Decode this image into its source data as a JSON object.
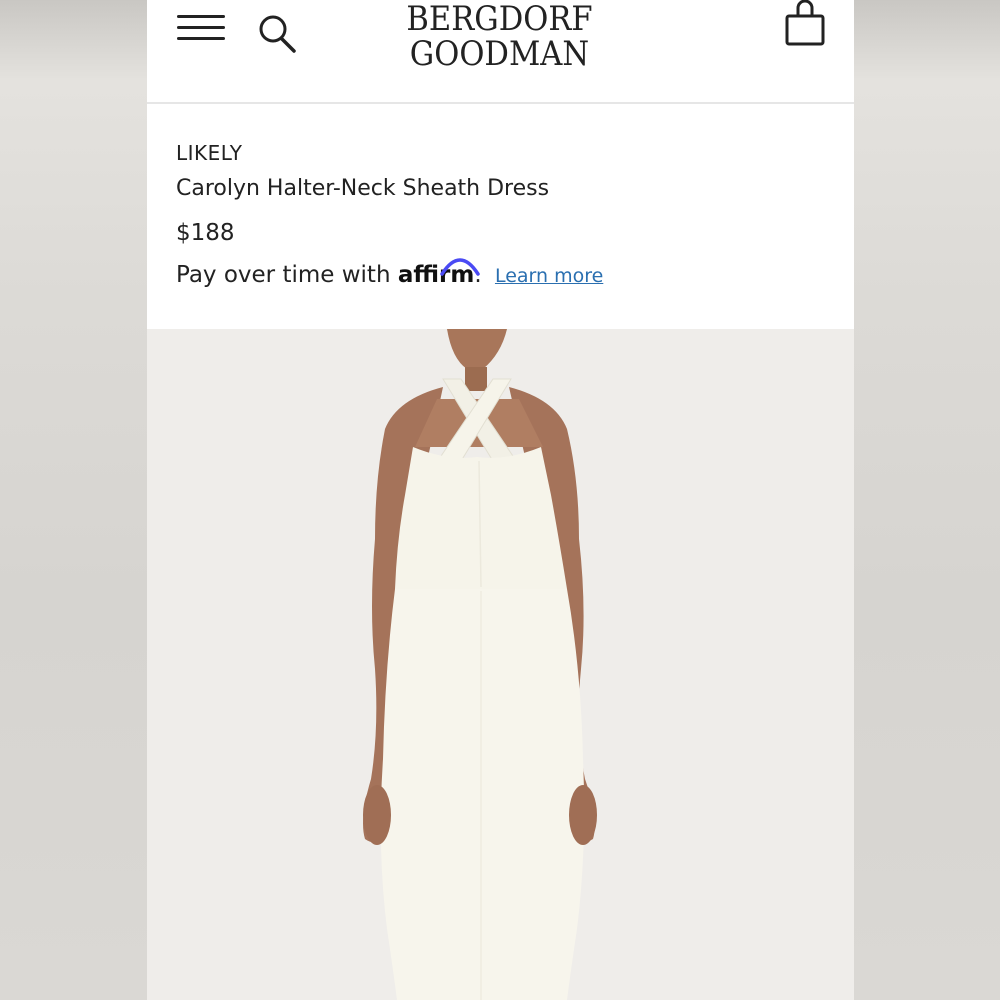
{
  "header": {
    "logo_line1": "BERGDORF",
    "logo_line2": "GOODMAN"
  },
  "product": {
    "brand": "LIKELY",
    "name": "Carolyn Halter-Neck Sheath Dress",
    "price": "$188",
    "financing": {
      "prefix": "Pay over time with",
      "provider": "affirm",
      "suffix": ".",
      "link_label": "Learn more"
    }
  },
  "icons": {
    "menu": "hamburger-menu-icon",
    "search": "search-icon",
    "bag": "shopping-bag-icon"
  },
  "colors": {
    "link": "#2a6fb0",
    "affirm_arc": "#4a4af4",
    "dress": "#f6f4ea",
    "background_photo": "#efedea"
  }
}
